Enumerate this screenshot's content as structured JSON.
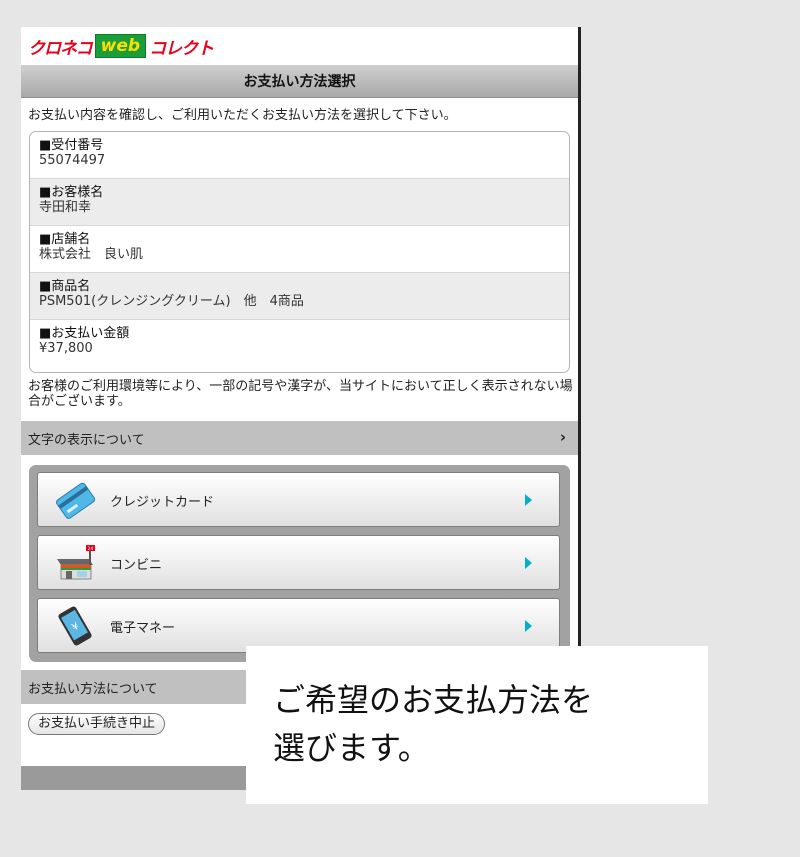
{
  "logo": {
    "left": "クロネコ",
    "web": "web",
    "right": "コレクト"
  },
  "title": "お支払い方法選択",
  "intro": "お支払い内容を確認し、ご利用いただくお支払い方法を選択して下さい。",
  "info": [
    {
      "label": "■受付番号",
      "value": "55074497"
    },
    {
      "label": "■お客様名",
      "value": "寺田和幸"
    },
    {
      "label": "■店舗名",
      "value": "株式会社　良い肌"
    },
    {
      "label": "■商品名",
      "value": "PSM501(クレンジングクリーム)　他　4商品"
    },
    {
      "label": "■お支払い金額",
      "value": "¥37,800"
    }
  ],
  "notice": "お客様のご利用環境等により、一部の記号や漢字が、当サイトにおいて正しく表示されない場合がございます。",
  "char_display_link": "文字の表示について",
  "chevron": "›",
  "methods": [
    {
      "label": "クレジットカード",
      "icon": "credit-card-icon"
    },
    {
      "label": "コンビニ",
      "icon": "convenience-store-icon"
    },
    {
      "label": "電子マネー",
      "icon": "mobile-phone-icon"
    }
  ],
  "store_sign": "24",
  "phone_symbol": "¥",
  "payment_info_link": "お支払い方法について",
  "cancel_label": "お支払い手続き中止",
  "overlay_text": "ご希望のお支払方法を\n選びます。",
  "colors": {
    "accent_red": "#e8001c",
    "logo_green": "#1a9e3a",
    "arrow_cyan": "#00b0cc"
  }
}
